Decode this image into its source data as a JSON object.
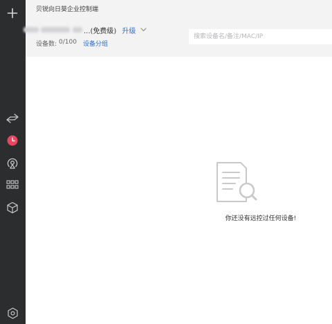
{
  "app": {
    "title": "贝锐向日葵企业控制端"
  },
  "account": {
    "name_suffix": "...(免费级)",
    "upgrade_label": "升级"
  },
  "devices": {
    "count_label": "设备数:",
    "count_value": "0/100",
    "group_link": "设备分组"
  },
  "search": {
    "placeholder": "搜索设备名/备注/MAC/IP",
    "value": ""
  },
  "empty_state": {
    "message": "你还没有远控过任何设备!"
  },
  "sidebar": {
    "icons": [
      "plus-icon",
      "remote-control-icon",
      "history-clock-icon",
      "cast-icon",
      "apps-grid-icon",
      "cube-icon",
      "settings-icon"
    ]
  },
  "colors": {
    "sidebar_bg": "#2c2d2f",
    "active_icon": "#e8455e",
    "link": "#2f6fd6",
    "header_bg": "#f3f3f4"
  }
}
